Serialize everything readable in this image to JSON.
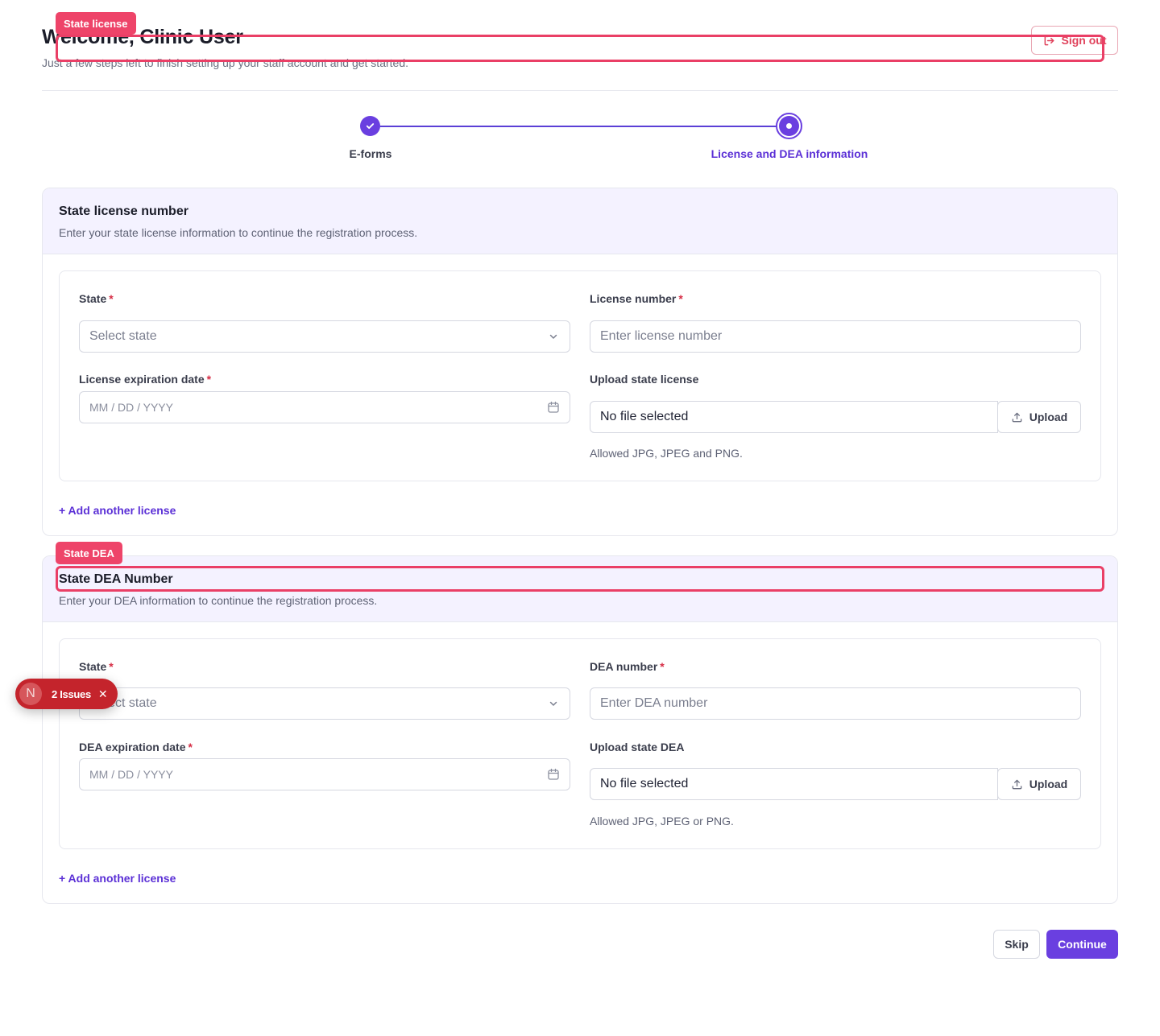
{
  "header": {
    "welcome": "Welcome, Clinic User",
    "subtitle": "Just a few steps left to finish setting up your staff account and get started.",
    "sign_out": "Sign out"
  },
  "stepper": {
    "steps": [
      {
        "label": "E-forms",
        "status": "done"
      },
      {
        "label": "License and DEA information",
        "status": "current"
      }
    ]
  },
  "license_section": {
    "title": "State license number",
    "description": "Enter your state license information to continue the registration process.",
    "state_label": "State",
    "state_placeholder": "Select state",
    "number_label": "License number",
    "number_placeholder": "Enter license number",
    "expiration_label": "License expiration date",
    "date_placeholder": "MM / DD / YYYY",
    "upload_label": "Upload state license",
    "file_status": "No file selected",
    "upload_button": "Upload",
    "help": "Allowed JPG, JPEG and PNG.",
    "add_link": "+ Add another license"
  },
  "dea_section": {
    "title": "State DEA Number",
    "description": "Enter your DEA information to continue the registration process.",
    "state_label": "State",
    "state_placeholder": "Select state",
    "number_label": "DEA number",
    "number_placeholder": "Enter DEA number",
    "expiration_label": "DEA expiration date",
    "date_placeholder": "MM / DD / YYYY",
    "upload_label": "Upload state DEA",
    "file_status": "No file selected",
    "upload_button": "Upload",
    "help": "Allowed JPG, JPEG or PNG.",
    "add_link": "+ Add another license"
  },
  "required_marker": "*",
  "footer": {
    "skip": "Skip",
    "continue": "Continue"
  },
  "overlays": {
    "badge_license": "State license",
    "badge_dea": "State DEA",
    "issues_initial": "N",
    "issues_text": "2 Issues",
    "issues_close": "✕"
  },
  "colors": {
    "accent": "#6a3fe0",
    "danger": "#d62d45",
    "overlay": "#ee4469",
    "section_bg": "#f4f2ff"
  }
}
